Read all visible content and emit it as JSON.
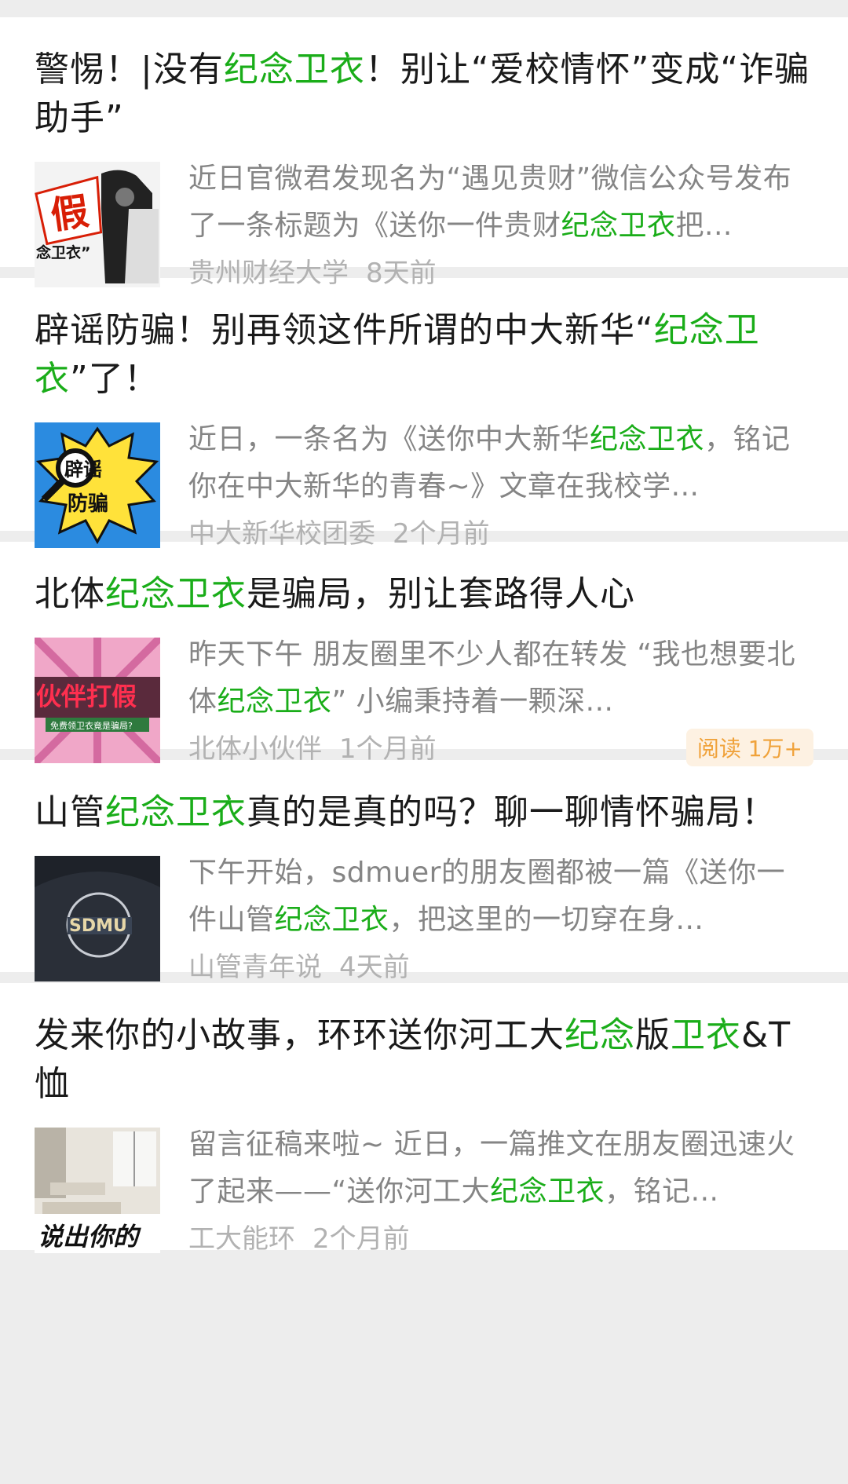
{
  "articles": [
    {
      "title_parts": [
        {
          "text": "警惕！|没有",
          "hl": false
        },
        {
          "text": "纪念卫衣",
          "hl": true
        },
        {
          "text": "！别让“爱校情怀”变成“诈骗助手”",
          "hl": false
        }
      ],
      "summary_parts": [
        {
          "text": "近日官微君发现名为“遇见贵财”微信公众号发布了一条标题为《送你一件贵财",
          "hl": false
        },
        {
          "text": "纪念卫衣",
          "hl": true
        },
        {
          "text": "把...",
          "hl": false
        }
      ],
      "source": "贵州财经大学",
      "time": "8天前",
      "thumb": {
        "icon": "fake-hoodie-icon",
        "text1": "假",
        "text2": "念卫衣”"
      }
    },
    {
      "title_parts": [
        {
          "text": "辟谣防骗！别再领这件所谓的中大新华“",
          "hl": false
        },
        {
          "text": "纪念卫衣",
          "hl": true
        },
        {
          "text": "”了！",
          "hl": false
        }
      ],
      "summary_parts": [
        {
          "text": "近日，一条名为《送你中大新华",
          "hl": false
        },
        {
          "text": "纪念卫衣",
          "hl": true
        },
        {
          "text": "，铭记你在中大新华的青春~》文章在我校学...",
          "hl": false
        }
      ],
      "source": "中大新华校团委",
      "time": "2个月前",
      "thumb": {
        "icon": "rumor-magnifier-icon",
        "text1": "辟谣",
        "text2": "防骗"
      }
    },
    {
      "title_parts": [
        {
          "text": "北体",
          "hl": false
        },
        {
          "text": "纪念卫衣",
          "hl": true
        },
        {
          "text": "是骗局，别让套路得人心",
          "hl": false
        }
      ],
      "summary_parts": [
        {
          "text": "昨天下午 朋友圈里不少人都在转发 “我也想要北体",
          "hl": false
        },
        {
          "text": "纪念卫衣",
          "hl": true
        },
        {
          "text": "” 小编秉持着一颗深...",
          "hl": false
        }
      ],
      "source": "北体小伙伴",
      "time": "1个月前",
      "badge": "阅读 1万+",
      "thumb": {
        "icon": "partner-fake-icon",
        "text1": "伙伴打假",
        "text2": "免费领卫衣竟是骗局?"
      }
    },
    {
      "title_parts": [
        {
          "text": "山管",
          "hl": false
        },
        {
          "text": "纪念卫衣",
          "hl": true
        },
        {
          "text": "真的是真的吗？聊一聊情怀骗局！",
          "hl": false
        }
      ],
      "summary_parts": [
        {
          "text": "下午开始，sdmuer的朋友圈都被一篇《送你一件山管",
          "hl": false
        },
        {
          "text": "纪念卫衣",
          "hl": true
        },
        {
          "text": "，把这里的一切穿在身...",
          "hl": false
        }
      ],
      "source": "山管青年说",
      "time": "4天前",
      "thumb": {
        "icon": "sdmu-hoodie-icon",
        "text1": "SDMU",
        "text2": ""
      }
    },
    {
      "title_parts": [
        {
          "text": "发来你的小故事，环环送你河工大",
          "hl": false
        },
        {
          "text": "纪念",
          "hl": true
        },
        {
          "text": "版",
          "hl": false
        },
        {
          "text": "卫衣",
          "hl": true
        },
        {
          "text": "&T恤",
          "hl": false
        }
      ],
      "summary_parts": [
        {
          "text": "留言征稿来啦~ 近日，一篇推文在朋友圈迅速火了起来——“送你河工大",
          "hl": false
        },
        {
          "text": "纪念卫衣",
          "hl": true
        },
        {
          "text": "，铭记...",
          "hl": false
        }
      ],
      "source": "工大能环",
      "time": "2个月前",
      "thumb": {
        "icon": "classroom-icon",
        "text1": "说出你的",
        "text2": ""
      }
    }
  ]
}
